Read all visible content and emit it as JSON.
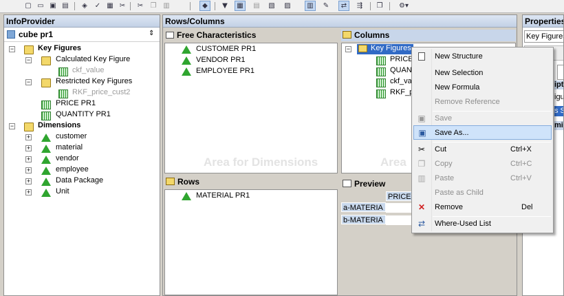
{
  "toolbar": {
    "icons": [
      "new-icon",
      "open-icon",
      "save-icon",
      "save-all-icon",
      "publish-icon",
      "check-icon",
      "properties-icon",
      "cut-icon",
      "copy-icon",
      "paste-icon",
      "infoprovider-icon",
      "filter-icon",
      "rows-columns-icon",
      "conditions-icon",
      "exceptions-icon",
      "table-icon",
      "cell-icon",
      "tasks-icon",
      "where-used-icon",
      "structure-icon",
      "tools-icon"
    ]
  },
  "infoprovider": {
    "header": "InfoProvider",
    "cube": "cube pr1",
    "key_figures": "Key Figures",
    "calculated": "Calculated Key Figure",
    "ckf_value": "ckf_value",
    "restricted": "Restricted Key Figures",
    "rkf": "RKF_price_cust2",
    "price": "PRICE PR1",
    "quantity": "QUANTITY PR1",
    "dimensions": "Dimensions",
    "dims": [
      "customer",
      "material",
      "vendor",
      "employee",
      "Data Package",
      "Unit"
    ]
  },
  "rows_columns": {
    "header": "Rows/Columns",
    "free": "Free Characteristics",
    "free_items": [
      "CUSTOMER PR1",
      "VENDOR  PR1",
      "EMPLOYEE PR1"
    ],
    "area_dims": "Area for Dimensions",
    "area_short": "Area",
    "columns": "Columns",
    "col_key_figures": "Key Figures",
    "col_items": [
      "PRICE",
      "QUANT",
      "ckf_va",
      "RKF_p"
    ],
    "rows": "Rows",
    "row_items": [
      "MATERIAL PR1"
    ],
    "preview": "Preview",
    "preview_col": "PRICE",
    "preview_rows": [
      "a-MATERIA",
      "b-MATERIA"
    ]
  },
  "properties": {
    "header": "Properties",
    "field": "Key Figures",
    "fragments": [
      "ipti",
      "igure",
      "s St",
      "mica"
    ]
  },
  "context_menu": {
    "new_structure": "New Structure",
    "new_selection": "New Selection",
    "new_formula": "New Formula",
    "remove_reference": "Remove Reference",
    "save": "Save",
    "save_as": "Save As...",
    "cut": "Cut",
    "cut_key": "Ctrl+X",
    "copy": "Copy",
    "copy_key": "Ctrl+C",
    "paste": "Paste",
    "paste_key": "Ctrl+V",
    "paste_child": "Paste as Child",
    "remove": "Remove",
    "remove_key": "Del",
    "where_used": "Where-Used List"
  }
}
